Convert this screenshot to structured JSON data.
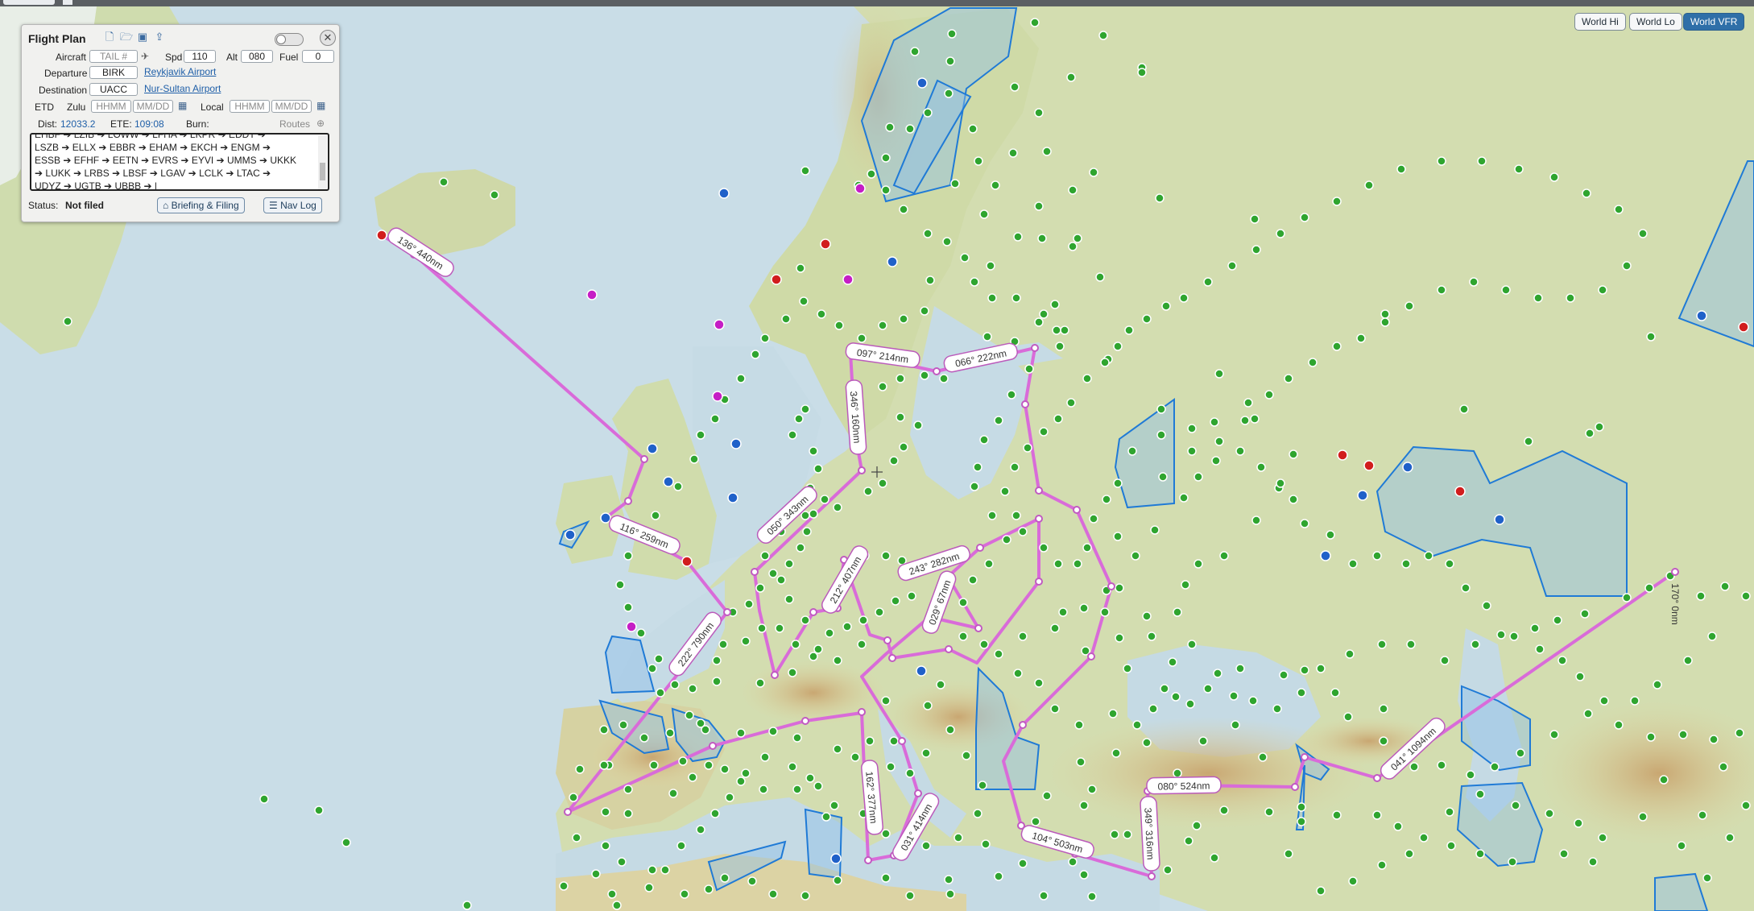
{
  "map_buttons": [
    {
      "label": "World Hi",
      "active": false
    },
    {
      "label": "World Lo",
      "active": false
    },
    {
      "label": "World VFR",
      "active": true
    }
  ],
  "flight_plan": {
    "title": "Flight Plan",
    "aircraft_label": "Aircraft",
    "aircraft_placeholder": "TAIL #",
    "spd_label": "Spd",
    "spd_value": "110",
    "alt_label": "Alt",
    "alt_value": "080",
    "fuel_label": "Fuel",
    "fuel_value": "0",
    "departure_label": "Departure",
    "departure_value": "BIRK",
    "departure_name": "Reykjavik Airport",
    "destination_label": "Destination",
    "destination_value": "UACC",
    "destination_name": "Nur-Sultan Airport",
    "etd_label": "ETD",
    "zulu_label": "Zulu",
    "time_placeholder": "HHMM",
    "date_placeholder": "MM/DD",
    "local_label": "Local",
    "dist_label": "Dist:",
    "dist_value": "12033.2",
    "ete_label": "ETE:",
    "ete_value": "109:08",
    "burn_label": "Burn:",
    "routes_label": "Routes",
    "route_lines": [
      "EHBF ➔ LZIB ➔ LOWW ➔ LFHA ➔ LKPR ➔ EDDT ➔",
      "LSZB ➔ ELLX ➔ EBBR ➔ EHAM ➔ EKCH ➔ ENGM ➔",
      "ESSB ➔ EFHF ➔ EETN ➔ EVRS ➔ EYVI ➔ UMMS ➔ UKKK",
      "➔ LUKK ➔ LRBS ➔ LBSF ➔ LGAV ➔ LCLK ➔ LTAC ➔",
      "UDYZ ➔ UGTB ➔ UBBB ➔ |"
    ],
    "status_label": "Status:",
    "status_value": "Not filed",
    "briefing_button": "Briefing & Filing",
    "navlog_button": "Nav Log"
  },
  "route_labels": [
    "136° 440nm",
    "097° 214nm",
    "066° 222nm",
    "346° 160nm",
    "050° 343nm",
    "116° 259nm",
    "212° 407nm",
    "243° 282nm",
    "029° 67nm",
    "222° 790nm",
    "162° 377nm",
    "031° 414nm",
    "104° 503nm",
    "349° 316nm",
    "080° 524nm",
    "041° 1094nm",
    "170° 0nm"
  ]
}
